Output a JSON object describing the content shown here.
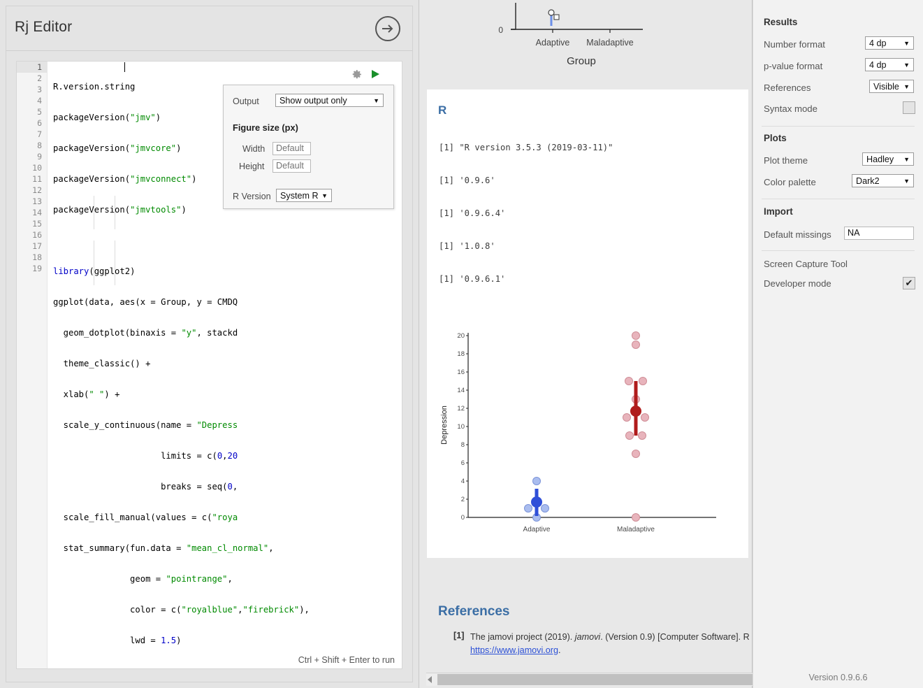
{
  "editor": {
    "title": "Rj Editor",
    "hide_icon": "arrow-right-circle-icon",
    "gear_icon": "gear-icon",
    "run_icon": "play-icon",
    "run_hint": "Ctrl + Shift + Enter to run",
    "line_numbers": [
      "1",
      "2",
      "3",
      "4",
      "5",
      "6",
      "7",
      "8",
      "9",
      "10",
      "11",
      "12",
      "13",
      "14",
      "15",
      "16",
      "17",
      "18",
      "19"
    ],
    "lines": [
      "R.version.string",
      "packageVersion(\"jmv\")",
      "packageVersion(\"jmvcore\")",
      "packageVersion(\"jmvconnect\")",
      "packageVersion(\"jmvtools\")",
      "",
      "library(ggplot2)",
      "ggplot(data, aes(x = Group, y = CMDQ",
      "  geom_dotplot(binaxis = \"y\", stackd",
      "  theme_classic() +",
      "  xlab(\" \") +",
      "  scale_y_continuous(name = \"Depress",
      "                     limits = c(0,20",
      "                     breaks = seq(0,",
      "  scale_fill_manual(values = c(\"roya",
      "  stat_summary(fun.data = \"mean_cl_normal\",",
      "               geom = \"pointrange\",",
      "               color = c(\"royalblue\",\"firebrick\"),",
      "               lwd = 1.5)"
    ]
  },
  "popup": {
    "output_label": "Output",
    "output_value": "Show output only",
    "figure_size_header": "Figure size (px)",
    "width_label": "Width",
    "width_placeholder": "Default",
    "height_label": "Height",
    "height_placeholder": "Default",
    "rversion_label": "R Version",
    "rversion_value": "System R",
    "chevron_icon": "chevron-down-icon"
  },
  "results": {
    "r_heading": "R",
    "output_lines": [
      "[1] \"R version 3.5.3 (2019-03-11)\"",
      "[1] '0.9.6'",
      "[1] '0.9.6.4'",
      "[1] '1.0.8'",
      "[1] '0.9.6.1'"
    ],
    "references_heading": "References",
    "ref1_marker": "[1]",
    "ref1_text_a": "The jamovi project (2019). ",
    "ref1_text_i": "jamovi",
    "ref1_text_b": ". (Version 0.9) [Computer Software]. R",
    "ref1_link": "https://www.jamovi.org",
    "ref1_tail": "."
  },
  "settings": {
    "results_header": "Results",
    "number_format_label": "Number format",
    "number_format_value": "4 dp",
    "pvalue_format_label": "p-value format",
    "pvalue_format_value": "4 dp",
    "references_label": "References",
    "references_value": "Visible",
    "syntax_mode_label": "Syntax mode",
    "syntax_mode_checked": "",
    "plots_header": "Plots",
    "plot_theme_label": "Plot theme",
    "plot_theme_value": "Hadley",
    "color_palette_label": "Color palette",
    "color_palette_value": "Dark2",
    "import_header": "Import",
    "default_missings_label": "Default missings",
    "default_missings_value": "NA",
    "screen_capture_label": "Screen Capture Tool",
    "developer_mode_label": "Developer mode",
    "developer_mode_checked": "✔",
    "chevron_icon": "chevron-down-icon"
  },
  "version_label": "Version 0.9.6.6",
  "colors": {
    "link": "#2a4fd6",
    "heading": "#3b6ea5",
    "adaptive": "#4169e1",
    "maladaptive": "#b22222",
    "run": "#1a8f2a"
  },
  "chart_data": {
    "type": "scatter",
    "title": "",
    "xlabel": "",
    "ylabel": "Depression",
    "categories": [
      "Adaptive",
      "Maladaptive"
    ],
    "ylim": [
      0,
      20
    ],
    "yticks": [
      0,
      2,
      4,
      6,
      8,
      10,
      12,
      14,
      16,
      18,
      20
    ],
    "grid": false,
    "legend": "none",
    "series": [
      {
        "name": "Adaptive",
        "color": "#4169e1",
        "points": [
          {
            "y": 4,
            "offset": 0
          },
          {
            "y": 1,
            "offset": -10
          },
          {
            "y": 1,
            "offset": 10
          },
          {
            "y": 0,
            "offset": 0
          }
        ],
        "mean": 1.7,
        "ci_low": 0.2,
        "ci_high": 3.2
      },
      {
        "name": "Maladaptive",
        "color": "#b22222",
        "points": [
          {
            "y": 20,
            "offset": 0
          },
          {
            "y": 19,
            "offset": 0
          },
          {
            "y": 15,
            "offset": -9
          },
          {
            "y": 15,
            "offset": 9
          },
          {
            "y": 13,
            "offset": 0
          },
          {
            "y": 11,
            "offset": -11
          },
          {
            "y": 11,
            "offset": 11
          },
          {
            "y": 9,
            "offset": -9
          },
          {
            "y": 9,
            "offset": 9
          },
          {
            "y": 7,
            "offset": 0
          },
          {
            "y": 0,
            "offset": 0
          }
        ],
        "mean": 11.7,
        "ci_low": 9.0,
        "ci_high": 15.0
      }
    ]
  },
  "top_chart": {
    "type": "scatter",
    "axis_label": "Group",
    "categories": [
      "Adaptive",
      "Maladaptive"
    ],
    "yticks": [
      "0"
    ]
  }
}
